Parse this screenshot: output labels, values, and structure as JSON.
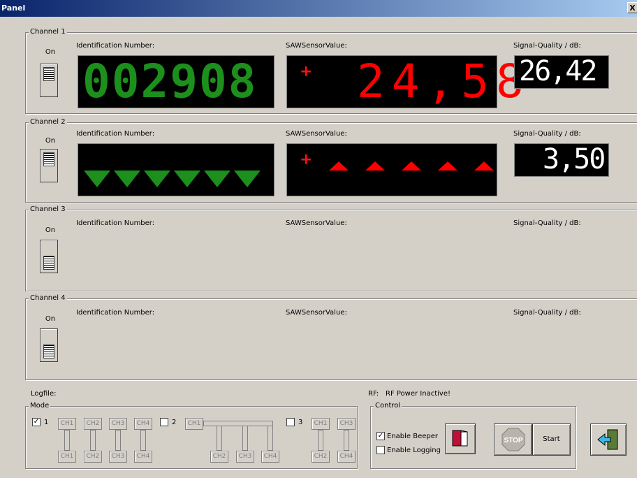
{
  "window": {
    "title": "Panel",
    "close": "X"
  },
  "labels": {
    "id": "Identification Number:",
    "saw": "SAWSensorValue:",
    "sq": "Signal-Quality / dB:",
    "on": "On"
  },
  "channels": [
    {
      "name": "Channel 1",
      "id_display": "002908",
      "saw_sign": "+",
      "saw_display": "24,58",
      "sq_display": "26,42"
    },
    {
      "name": "Channel 2",
      "saw_sign": "+",
      "sq_display": "3,50"
    },
    {
      "name": "Channel 3"
    },
    {
      "name": "Channel 4"
    }
  ],
  "logfile": {
    "label": "Logfile:"
  },
  "rf": {
    "label": "RF:",
    "status": "RF Power Inactive!"
  },
  "mode": {
    "title": "Mode",
    "opt1": "1",
    "opt2": "2",
    "opt3": "3",
    "ch1": "CH1",
    "ch2": "CH2",
    "ch3": "CH3",
    "ch4": "CH4"
  },
  "control": {
    "title": "Control",
    "beeper": "Enable Beeper",
    "logging": "Enable Logging",
    "stop": "STOP",
    "start": "Start"
  },
  "colors": {
    "led_green": "#1c8f1c",
    "led_red": "#ff0000",
    "led_white": "#ffffff"
  },
  "icons": {
    "book": "book-icon",
    "exit": "exit-door-icon"
  }
}
